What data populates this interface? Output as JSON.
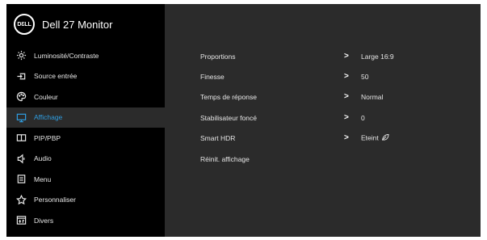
{
  "brand": {
    "logo_text": "DƐLL",
    "title": "Dell 27 Monitor"
  },
  "menu": [
    {
      "label": "Luminosité/Contraste",
      "icon": "brightness-icon",
      "active": false
    },
    {
      "label": "Source entrée",
      "icon": "input-source-icon",
      "active": false
    },
    {
      "label": "Couleur",
      "icon": "color-icon",
      "active": false
    },
    {
      "label": "Affichage",
      "icon": "display-icon",
      "active": true
    },
    {
      "label": "PIP/PBP",
      "icon": "pip-icon",
      "active": false
    },
    {
      "label": "Audio",
      "icon": "speaker-icon",
      "active": false
    },
    {
      "label": "Menu",
      "icon": "menu-icon",
      "active": false
    },
    {
      "label": "Personnaliser",
      "icon": "star-icon",
      "active": false
    },
    {
      "label": "Divers",
      "icon": "others-icon",
      "active": false
    }
  ],
  "settings": [
    {
      "label": "Proportions",
      "chevron": ">",
      "value": "Large 16:9"
    },
    {
      "label": "Finesse",
      "chevron": ">",
      "value": "50"
    },
    {
      "label": "Temps de réponse",
      "chevron": ">",
      "value": "Normal"
    },
    {
      "label": "Stabilisateur foncé",
      "chevron": ">",
      "value": "0"
    },
    {
      "label": "Smart HDR",
      "chevron": ">",
      "value": "Eteint",
      "icon": "leaf-icon"
    },
    {
      "label": "Réinit. affichage"
    }
  ],
  "colors": {
    "accent": "#2f9de0",
    "panel": "#2b2b2b",
    "background": "#000000"
  }
}
